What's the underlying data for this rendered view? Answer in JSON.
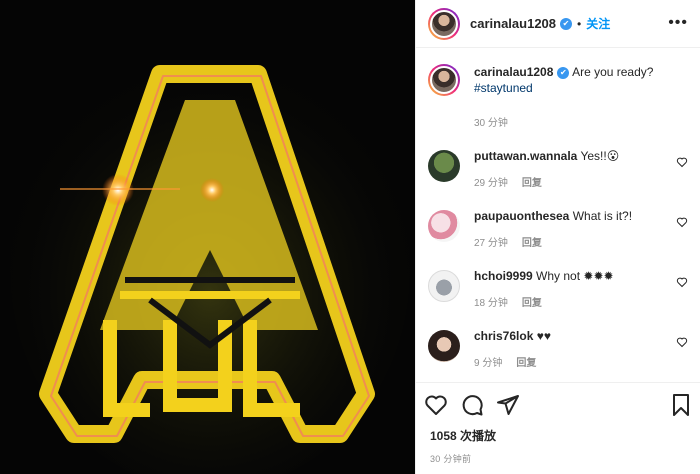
{
  "post": {
    "username": "carinalau1208",
    "verified_mark": "✔",
    "dot": "•",
    "follow_label": "关注",
    "more_label": "•••",
    "caption_text": "Are you ready?",
    "caption_tag": "#staytuned",
    "caption_time": "30 分钟",
    "reply_label": "回复"
  },
  "comments": [
    {
      "user": "puttawan.wannala",
      "text": "Yes!!😮",
      "time": "29 分钟"
    },
    {
      "user": "paupauonthesea",
      "text": "What is it?!",
      "time": "27 分钟"
    },
    {
      "user": "hchoi9999",
      "text": "Why not ✹✹✹",
      "time": "18 分钟"
    },
    {
      "user": "chris76lok",
      "text": "♥♥",
      "time": "9 分钟"
    }
  ],
  "stats": {
    "views": "1058 次播放",
    "posted_ago": "30 分钟前"
  },
  "icons": [
    "heart-icon",
    "comment-icon",
    "share-icon",
    "save-icon",
    "verified-icon",
    "more-icon"
  ],
  "colors": {
    "accent": "#0095f6",
    "logo_yellow": "#f3d11c",
    "media_bg": "#050505"
  }
}
